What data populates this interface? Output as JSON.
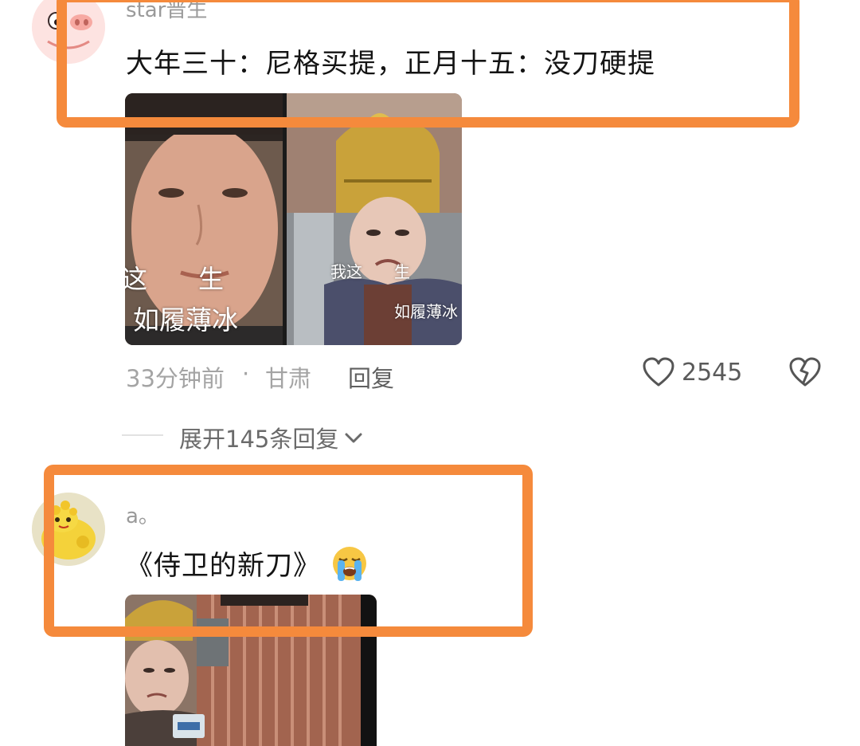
{
  "comments": [
    {
      "username": "star晋生",
      "text": "大年三十：尼格买提，正月十五：没刀硬提",
      "image": {
        "left_caption_line1": "这　　生",
        "left_caption_line2": "如履薄冰",
        "right_caption_line1": "我这　　生",
        "right_caption_line2": "如履薄冰"
      },
      "time": "33分钟前",
      "separator": "·",
      "region": "甘肃",
      "reply_label": "回复",
      "like_count": "2545"
    },
    {
      "username": "a。",
      "text": "《侍卫的新刀》",
      "emoji": "loudly-crying-face"
    }
  ],
  "expand_replies_label": "展开145条回复",
  "colors": {
    "highlight": "#f58a3c",
    "text_primary": "#141414",
    "text_secondary": "#a4a4a4"
  }
}
